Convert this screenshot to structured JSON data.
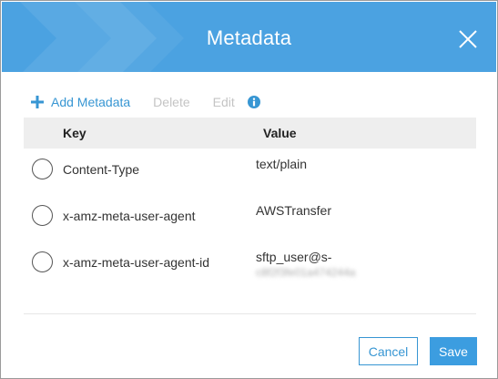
{
  "dialog": {
    "title": "Metadata"
  },
  "toolbar": {
    "add_label": "Add Metadata",
    "delete_label": "Delete",
    "edit_label": "Edit"
  },
  "table": {
    "columns": [
      "Key",
      "Value"
    ],
    "rows": [
      {
        "key": "Content-Type",
        "value": "text/plain",
        "value_line2": ""
      },
      {
        "key": "x-amz-meta-user-agent",
        "value": "AWSTransfer",
        "value_line2": ""
      },
      {
        "key": "x-amz-meta-user-agent-id",
        "value": "sftp_user@s-",
        "value_line2": "c8f2f3fe01a474244a"
      }
    ]
  },
  "footer": {
    "cancel_label": "Cancel",
    "save_label": "Save"
  },
  "colors": {
    "header": "#4ba2e1",
    "accent": "#3796d3",
    "disabled": "#c4c4c4"
  },
  "icons": {
    "add": "plus-icon",
    "info": "info-icon",
    "close": "close-icon"
  }
}
